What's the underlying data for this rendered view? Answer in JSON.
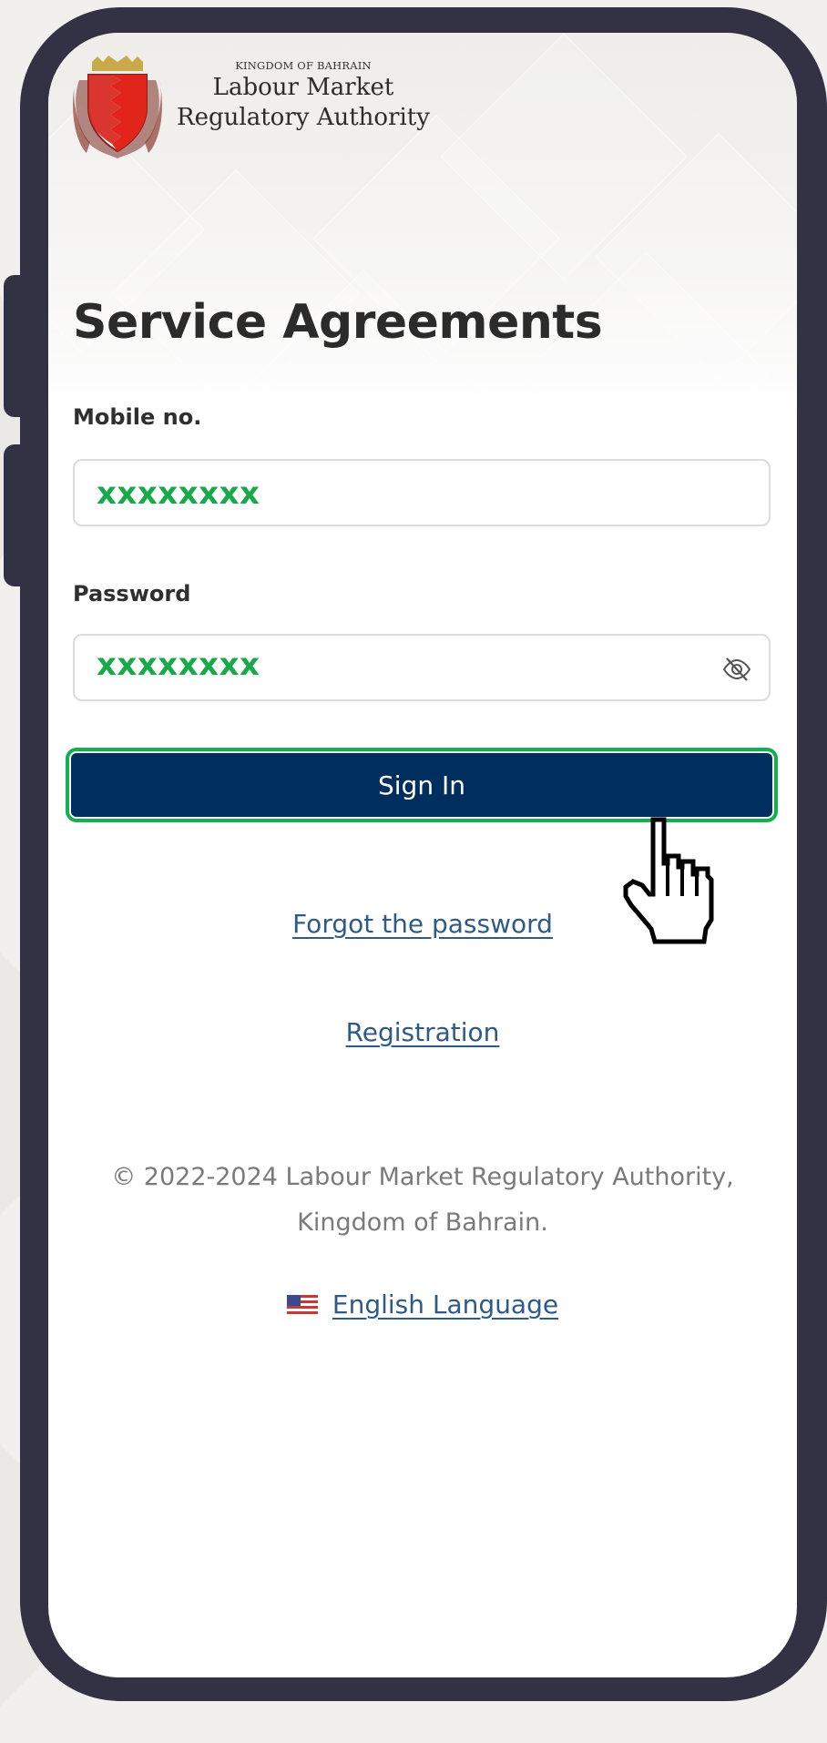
{
  "header": {
    "kingdom": "KINGDOM OF BAHRAIN",
    "org_line1": "Labour Market",
    "org_line2": "Regulatory Authority",
    "emblem_icon": "bahrain-emblem-icon"
  },
  "page": {
    "title": "Service Agreements"
  },
  "form": {
    "mobile_label": "Mobile no.",
    "mobile_value": "xxxxxxxx",
    "password_label": "Password",
    "password_value": "xxxxxxxx",
    "visibility_icon": "eye-off-icon",
    "sign_in_label": "Sign In",
    "highlight_color": "#12b04e",
    "value_color": "#18a94b",
    "button_color": "#002e5e"
  },
  "links": {
    "forgot_password": "Forgot the password",
    "registration": "Registration"
  },
  "footer": {
    "copyright_line1": "© 2022-2024 Labour Market Regulatory Authority,",
    "copyright_line2": "Kingdom of Bahrain.",
    "language_label": "English Language",
    "flag_icon": "us-flag-icon"
  },
  "cursor": {
    "icon": "hand-pointer-icon"
  }
}
